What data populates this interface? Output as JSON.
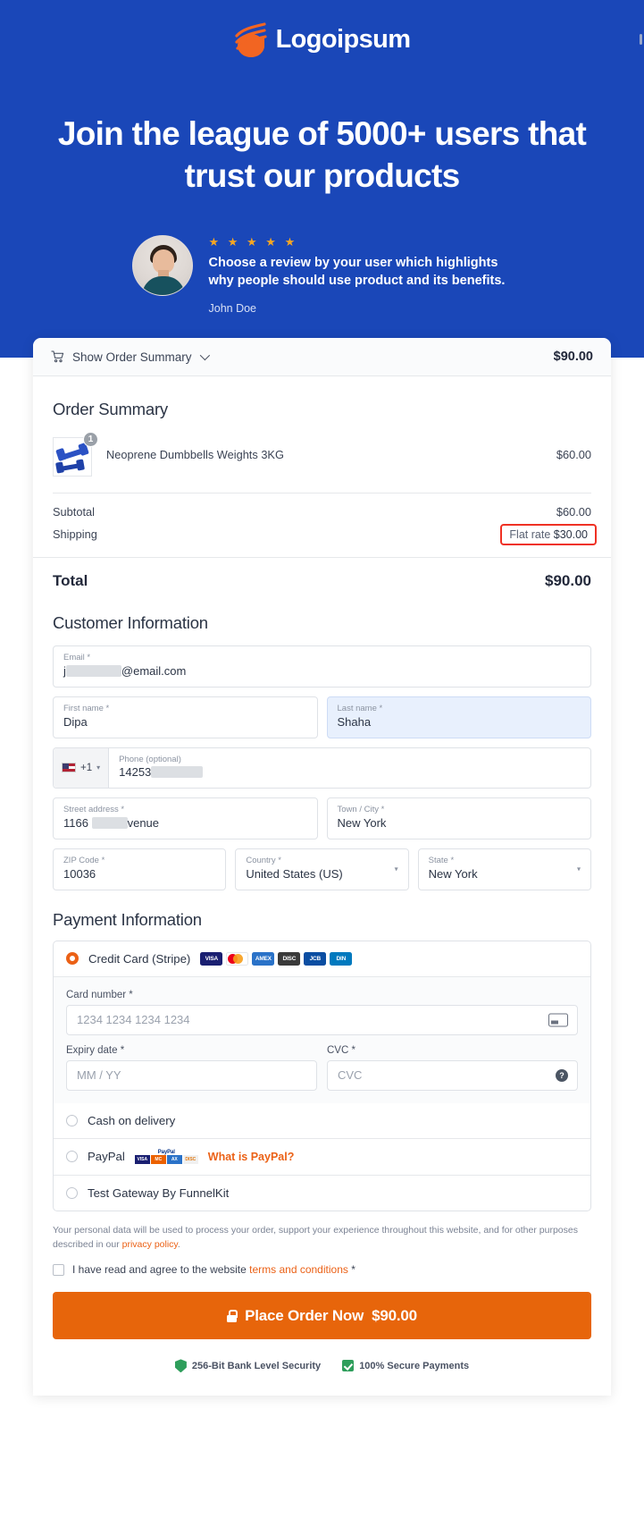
{
  "hero": {
    "logo_text": "Logoipsum",
    "logo_icon": "logoipsum-wave-icon",
    "title": "Join the league of 5000+ users that trust our products",
    "testimonial": {
      "avatar_icon": "user-avatar",
      "stars": "★ ★ ★ ★ ★",
      "star_count": 5,
      "quote": "Choose a review by your user which highlights why people should use product and its benefits.",
      "author": "John Doe"
    },
    "background_color": "#1a47b8"
  },
  "summary_bar": {
    "cart_icon": "shopping-cart-icon",
    "label": "Show Order Summary",
    "chevron_icon": "chevron-down-icon",
    "amount": "$90.00"
  },
  "order_summary": {
    "heading": "Order Summary",
    "items": [
      {
        "thumb_icon": "dumbbell-product-image",
        "qty": "1",
        "name": "Neoprene Dumbbells Weights 3KG",
        "price": "$60.00"
      }
    ],
    "subtotal_label": "Subtotal",
    "subtotal_value": "$60.00",
    "shipping_label": "Shipping",
    "shipping_method": "Flat rate",
    "shipping_value": "$30.00",
    "total_label": "Total",
    "total_value": "$90.00",
    "highlight_color": "#ef3124"
  },
  "customer": {
    "heading": "Customer Information",
    "email": {
      "label": "Email *",
      "value_prefix": "j",
      "value_suffix": "@email.com",
      "redacted": true
    },
    "first_name": {
      "label": "First name *",
      "value": "Dipa"
    },
    "last_name": {
      "label": "Last name *",
      "value": "Shaha",
      "focused": true
    },
    "phone": {
      "label": "Phone (optional)",
      "country_code": "+1",
      "flag_icon": "us-flag-icon",
      "value_prefix": "14253",
      "redacted": true
    },
    "street": {
      "label": "Street address *",
      "value_prefix": "1166",
      "value_suffix": "venue",
      "redacted": true
    },
    "city": {
      "label": "Town / City *",
      "value": "New York"
    },
    "zip": {
      "label": "ZIP Code *",
      "value": "10036"
    },
    "country": {
      "label": "Country *",
      "value": "United States (US)"
    },
    "state": {
      "label": "State *",
      "value": "New York"
    }
  },
  "payment": {
    "heading": "Payment Information",
    "methods": [
      {
        "id": "stripe",
        "label": "Credit Card (Stripe)",
        "selected": true,
        "cards": [
          "VISA",
          "MC",
          "AMEX",
          "DISCOVER",
          "JCB",
          "DINERS"
        ]
      },
      {
        "id": "cod",
        "label": "Cash on delivery",
        "selected": false
      },
      {
        "id": "paypal",
        "label": "PayPal",
        "selected": false,
        "link": "What is PayPal?"
      },
      {
        "id": "funnelkit",
        "label": "Test Gateway By FunnelKit",
        "selected": false
      }
    ],
    "card_number": {
      "label": "Card number *",
      "placeholder": "1234 1234 1234 1234",
      "icon": "credit-card-icon"
    },
    "expiry": {
      "label": "Expiry date *",
      "placeholder": "MM / YY"
    },
    "cvc": {
      "label": "CVC *",
      "placeholder": "CVC",
      "icon": "help-circle-icon"
    }
  },
  "footer": {
    "privacy_text_1": "Your personal data will be used to process your order, support your experience throughout this website, and for other purposes described in our ",
    "privacy_link": "privacy policy",
    "privacy_text_2": ".",
    "agree_text_1": "I have read and agree to the website ",
    "agree_link": "terms and conditions",
    "agree_text_2": " *",
    "place_order_label": "Place Order Now",
    "place_order_amount": "$90.00",
    "lock_icon": "lock-icon",
    "trust": [
      {
        "icon": "shield-icon",
        "label": "256-Bit Bank Level Security"
      },
      {
        "icon": "green-check-icon",
        "label": "100% Secure Payments"
      }
    ],
    "button_color": "#e7650b"
  }
}
